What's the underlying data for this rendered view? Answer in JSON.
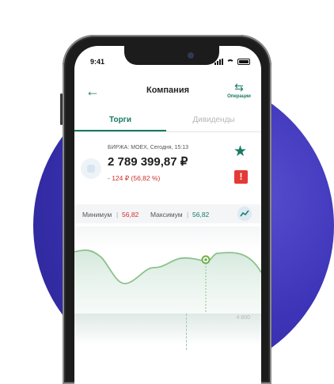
{
  "status_bar": {
    "time": "9:41"
  },
  "header": {
    "title": "Компания",
    "back_icon": "arrow-left-icon",
    "operations_label": "Операции",
    "operations_icon": "swap-arrows-icon"
  },
  "tabs": [
    {
      "label": "Торги",
      "active": true
    },
    {
      "label": "Дивиденды",
      "active": false
    }
  ],
  "quote": {
    "exchange_line": "БИРЖА: MOEX, Сегодня, 15:13",
    "price": "2 789 399,87 ₽",
    "change": "- 124 ₽ (56,82 %)",
    "favorite_icon": "star-icon",
    "alert_icon": "exclamation-icon"
  },
  "range": {
    "min_label": "Минимум",
    "min_value": "56,82",
    "max_label": "Максимум",
    "max_value": "56,82",
    "chart_icon": "trend-line-icon"
  },
  "chart": {
    "axis_label_low": "4 800"
  },
  "colors": {
    "accent": "#177a63",
    "negative": "#d32f2f",
    "background_circle": "#3d34b8"
  }
}
